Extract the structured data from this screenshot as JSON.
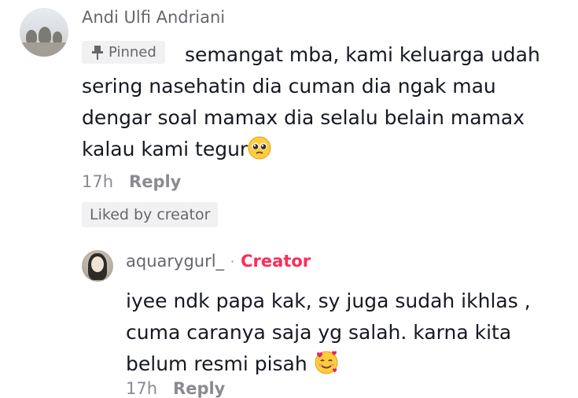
{
  "comment": {
    "username": "Andi Ulfi Andriani",
    "pinned_label": "Pinned",
    "line1": "semangat mba, kami keluarga udah",
    "line2": "sering nasehatin dia cuman dia ngak mau",
    "line3": "dengar soal mamax dia selalu belain mamax",
    "line4": "kalau kami tegur",
    "emoji": "pleading-face",
    "time": "17h",
    "reply_label": "Reply",
    "liked_label": "Liked by creator"
  },
  "reply": {
    "username": "aquarygurl_",
    "separator": "·",
    "badge": "Creator",
    "line1": "iyee ndk papa kak, sy juga sudah ikhlas ,",
    "line2": "cuma caranya saja yg salah. karna kita",
    "line3": "belum resmi pisah",
    "emoji": "smiling-face-with-hearts",
    "time": "17h",
    "reply_label": "Reply"
  },
  "colors": {
    "secondary_text": "#66676d",
    "muted_text": "#8a8b91",
    "badge_bg": "#f1f1f2",
    "creator_accent": "#fe2c55"
  }
}
